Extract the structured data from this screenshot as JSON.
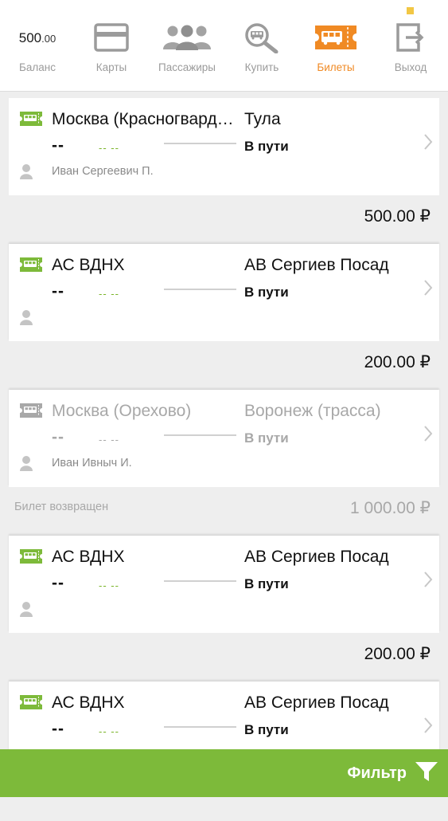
{
  "colors": {
    "accent": "#f08a24",
    "green": "#7dba3a",
    "muted": "#a8a8a8"
  },
  "nav": {
    "balance": {
      "amount": "500",
      "cents": ".00",
      "label": "Баланс"
    },
    "items": [
      {
        "label": "Карты",
        "icon": "card-icon"
      },
      {
        "label": "Пассажиры",
        "icon": "passengers-icon"
      },
      {
        "label": "Купить",
        "icon": "search-bus-icon"
      },
      {
        "label": "Билеты",
        "icon": "ticket-icon",
        "active": true
      },
      {
        "label": "Выход",
        "icon": "exit-icon"
      }
    ]
  },
  "tickets": [
    {
      "from": "Москва (Красногвардейская)",
      "to": "Тула",
      "time": "--",
      "date": "-- --",
      "status": "В пути",
      "passenger": "Иван Сергеевич П.",
      "price": "500.00 ₽",
      "note": ""
    },
    {
      "from": "АС ВДНХ",
      "to": "АВ Сергиев Посад",
      "time": "--",
      "date": "-- --",
      "status": "В пути",
      "passenger": "",
      "price": "200.00 ₽",
      "note": ""
    },
    {
      "from": "Москва (Орехово)",
      "to": "Воронеж (трасса)",
      "time": "--",
      "date": "-- --",
      "status": "В пути",
      "passenger": "Иван Ивныч И.",
      "price": "1 000.00 ₽",
      "note": "Билет возвращен",
      "returned": true
    },
    {
      "from": "АС ВДНХ",
      "to": "АВ Сергиев Посад",
      "time": "--",
      "date": "-- --",
      "status": "В пути",
      "passenger": "",
      "price": "200.00 ₽",
      "note": ""
    },
    {
      "from": "АС ВДНХ",
      "to": "АВ Сергиев Посад",
      "time": "--",
      "date": "-- --",
      "status": "В пути",
      "passenger": "",
      "price": "",
      "note": ""
    }
  ],
  "filter": {
    "label": "Фильтр",
    "icon": "filter-icon"
  }
}
